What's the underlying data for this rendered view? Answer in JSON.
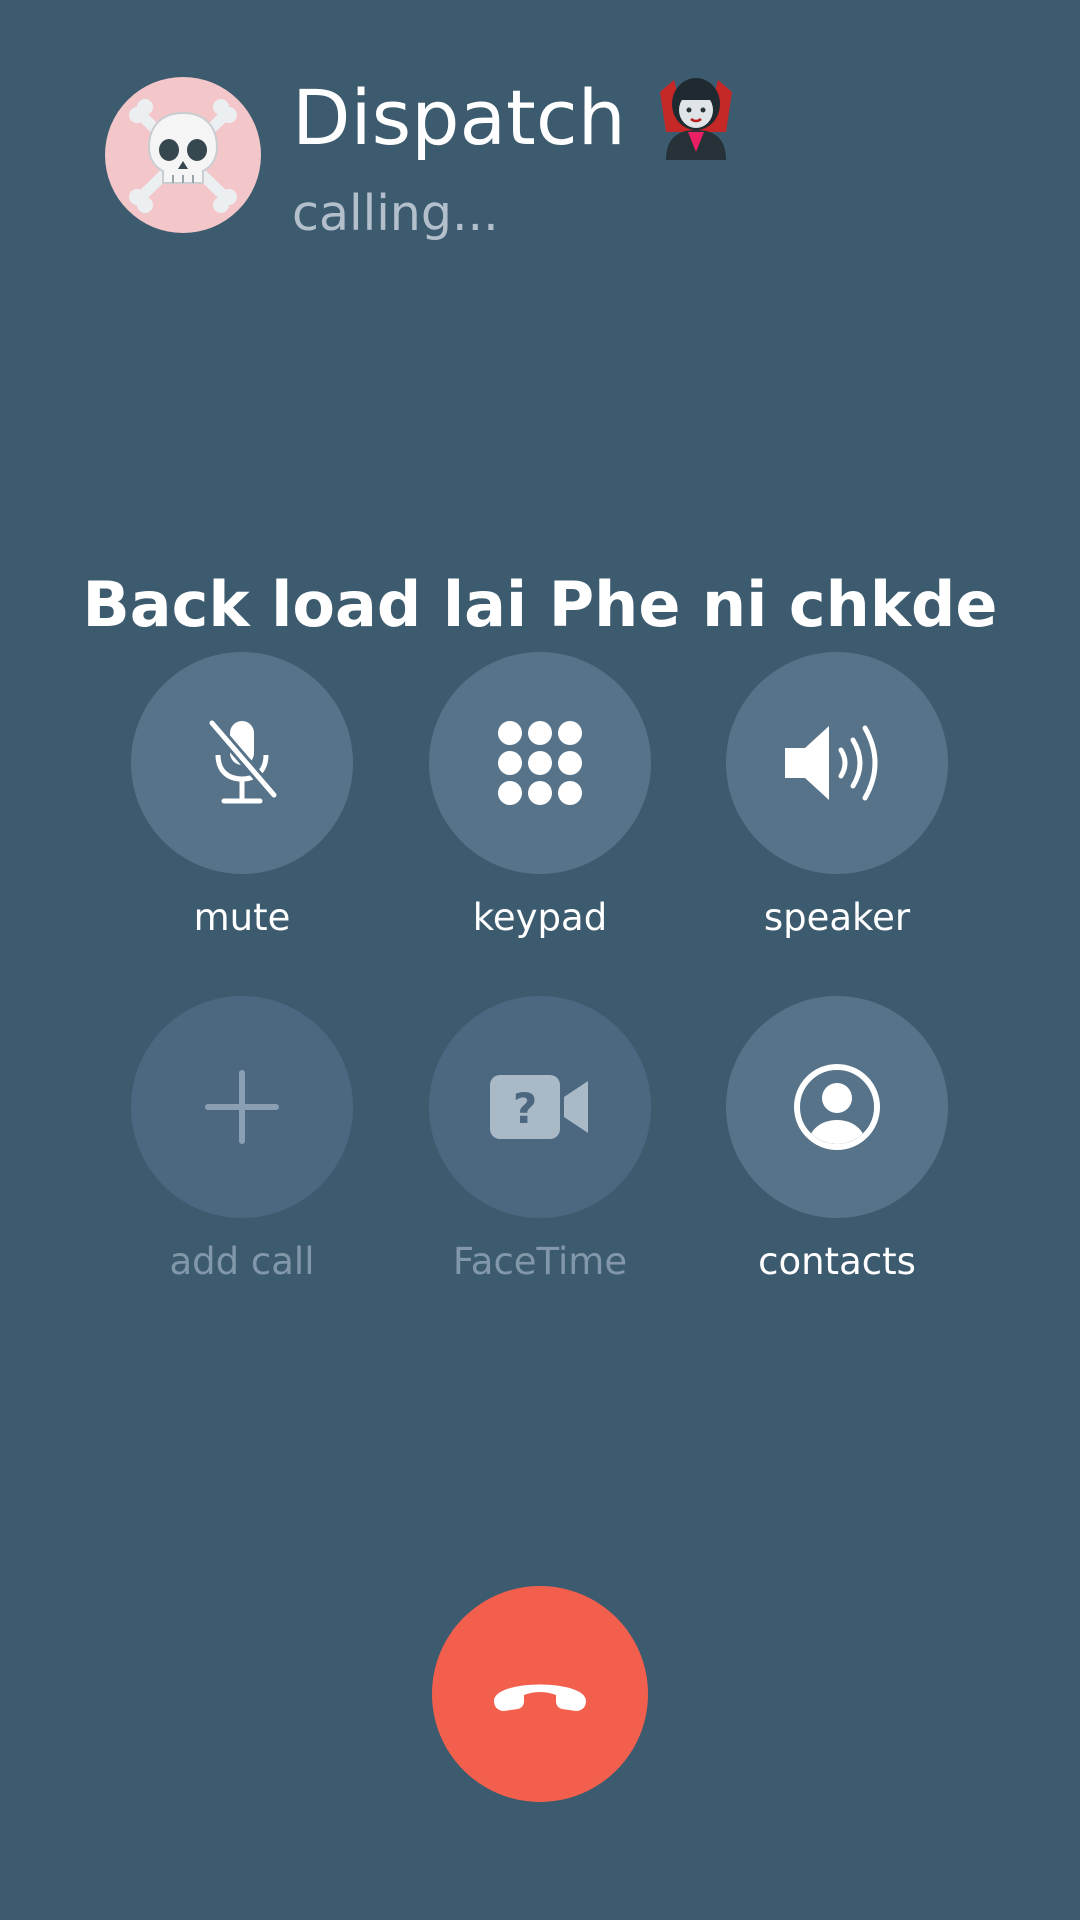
{
  "caller": {
    "name": "Dispatch",
    "name_emoji": "vampire-emoji",
    "avatar_icon": "skull-crossbones-icon",
    "status": "calling..."
  },
  "banner_text": "Back load lai Phe ni chkde",
  "controls": [
    {
      "label": "mute",
      "icon": "microphone-slash-icon",
      "enabled": true
    },
    {
      "label": "keypad",
      "icon": "keypad-icon",
      "enabled": true
    },
    {
      "label": "speaker",
      "icon": "speaker-icon",
      "enabled": true
    },
    {
      "label": "add call",
      "icon": "plus-icon",
      "enabled": false
    },
    {
      "label": "FaceTime",
      "icon": "facetime-question-icon",
      "enabled": false
    },
    {
      "label": "contacts",
      "icon": "contact-person-icon",
      "enabled": true
    }
  ],
  "end_call": {
    "icon": "phone-hangup-icon"
  },
  "colors": {
    "background": "#3d5b6f",
    "button": "#56738a",
    "button_disabled": "#4b6880",
    "end_call": "#f35f4d",
    "avatar_bg": "#f3c7c9"
  }
}
